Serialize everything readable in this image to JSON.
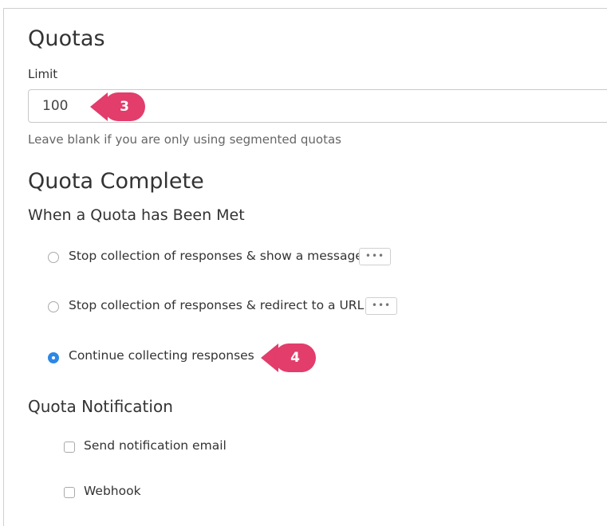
{
  "quotas": {
    "title": "Quotas",
    "limit_label": "Limit",
    "limit_value": "100",
    "help_text": "Leave blank if you are only using segmented quotas"
  },
  "quota_complete": {
    "title": "Quota Complete",
    "subtitle": "When a Quota has Been Met",
    "options": [
      {
        "label": "Stop collection of responses & show a message",
        "selected": false,
        "has_more": true
      },
      {
        "label": "Stop collection of responses & redirect to a URL",
        "selected": false,
        "has_more": true
      },
      {
        "label": "Continue collecting responses",
        "selected": true,
        "has_more": false
      }
    ],
    "more_label": "•••"
  },
  "quota_notification": {
    "title": "Quota Notification",
    "options": [
      {
        "label": "Send notification email",
        "checked": false
      },
      {
        "label": "Webhook",
        "checked": false
      }
    ]
  },
  "callouts": {
    "step3": "3",
    "step4": "4"
  },
  "colors": {
    "callout": "#e23d6b",
    "radio_selected": "#2d87e6"
  }
}
